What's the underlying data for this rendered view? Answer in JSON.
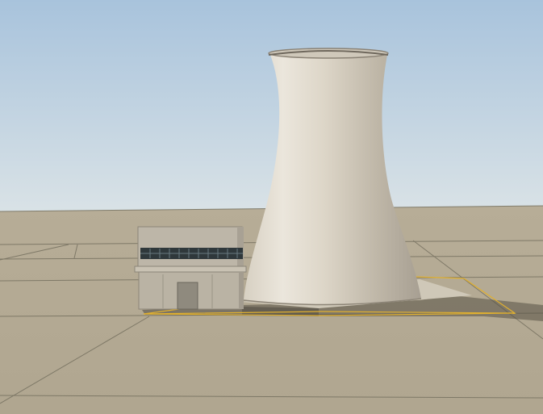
{
  "scene": {
    "sky_top_color": "#a9c4dc",
    "sky_horizon_color": "#dbe3e7",
    "ground_color": "#b3aa94",
    "ground_grid_color": "#6e6a60",
    "tower_light_color": "#e6e0d4",
    "tower_shadow_color": "#9e968a",
    "building_wall_color": "#bcb5a6",
    "building_window_color": "#2f3a3e",
    "selection_outline_color": "#e0b030",
    "shadow_color": "#4a463e"
  }
}
